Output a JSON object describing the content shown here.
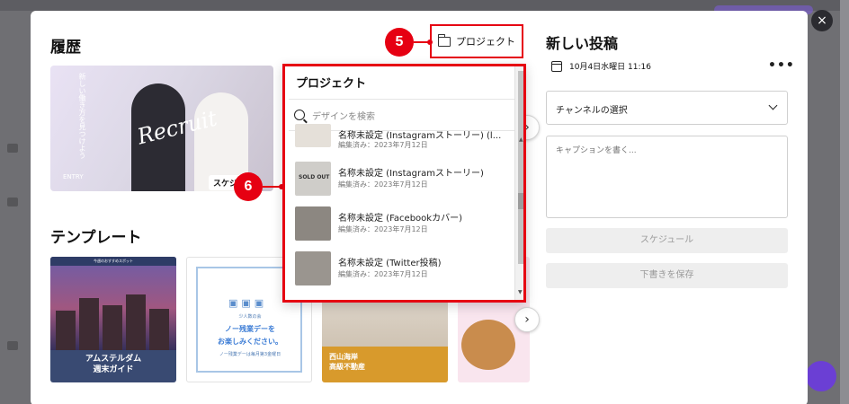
{
  "modal": {
    "history_title": "履歴",
    "templates_title": "テンプレート",
    "project_button": "プロジェクト",
    "close_icon": "×"
  },
  "callouts": {
    "five": "5",
    "six": "6"
  },
  "history_card": {
    "vertical_text": "新しい働き方を見つけよう",
    "script_text": "Recruit",
    "entry_label": "ENTRY",
    "schedule_badge": "スケジ"
  },
  "templates": [
    {
      "header": "今週のおすすめスポット",
      "line1": "アムステルダム",
      "line2": "週末ガイド"
    },
    {
      "small_top": "少人数の会",
      "line1": "ノー残業デーを",
      "line2": "お楽しみください。",
      "small_bottom": "ノー残業デーは毎月第3金曜日"
    },
    {
      "line1": "西山海岸",
      "line2": "高級不動産"
    },
    {
      "line1": ""
    }
  ],
  "dropdown": {
    "title": "プロジェクト",
    "search_placeholder": "デザインを検索",
    "items": [
      {
        "name": "名称未設定 (Instagramストーリー) (l...",
        "meta": "編集済み：2023年7月12日"
      },
      {
        "name": "名称未設定 (Instagramストーリー)",
        "meta": "編集済み：2023年7月12日",
        "thumb_text": "SOLD OUT"
      },
      {
        "name": "名称未設定 (Facebookカバー)",
        "meta": "編集済み：2023年7月12日"
      },
      {
        "name": "名称未設定 (Twitter投稿)",
        "meta": "編集済み：2023年7月12日"
      }
    ]
  },
  "post_panel": {
    "title": "新しい投稿",
    "datetime": "10月4日水曜日 11:16",
    "more_icon": "•••",
    "channel_select": "チャンネルの選択",
    "caption_placeholder": "キャプションを書く...",
    "schedule_button": "スケジュール",
    "save_draft_button": "下書きを保存"
  },
  "icons": {
    "close": "close-icon",
    "folder": "folder-icon",
    "search": "search-icon",
    "calendar": "calendar-icon",
    "more": "more-icon",
    "chevron": "chevron-down-icon",
    "arrow_right": "chevron-right-icon"
  },
  "colors": {
    "callout_red": "#e60012",
    "accent_purple": "#6b3fd4"
  }
}
